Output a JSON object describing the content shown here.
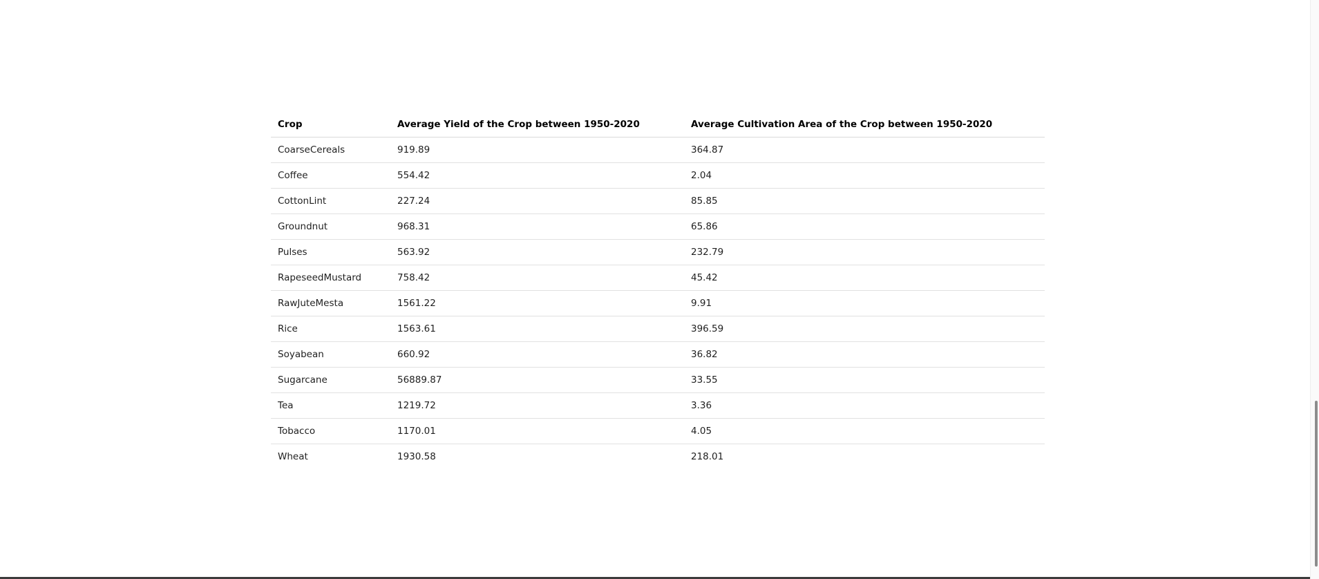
{
  "table": {
    "headers": [
      "Crop",
      "Average Yield of the Crop between 1950-2020",
      "Average Cultivation Area of the Crop between 1950-2020"
    ],
    "rows": [
      [
        "CoarseCereals",
        "919.89",
        "364.87"
      ],
      [
        "Coffee",
        "554.42",
        "2.04"
      ],
      [
        "CottonLint",
        "227.24",
        "85.85"
      ],
      [
        "Groundnut",
        "968.31",
        "65.86"
      ],
      [
        "Pulses",
        "563.92",
        "232.79"
      ],
      [
        "RapeseedMustard",
        "758.42",
        "45.42"
      ],
      [
        "RawJuteMesta",
        "1561.22",
        "9.91"
      ],
      [
        "Rice",
        "1563.61",
        "396.59"
      ],
      [
        "Soyabean",
        "660.92",
        "36.82"
      ],
      [
        "Sugarcane",
        "56889.87",
        "33.55"
      ],
      [
        "Tea",
        "1219.72",
        "3.36"
      ],
      [
        "Tobacco",
        "1170.01",
        "4.05"
      ],
      [
        "Wheat",
        "1930.58",
        "218.01"
      ]
    ]
  }
}
